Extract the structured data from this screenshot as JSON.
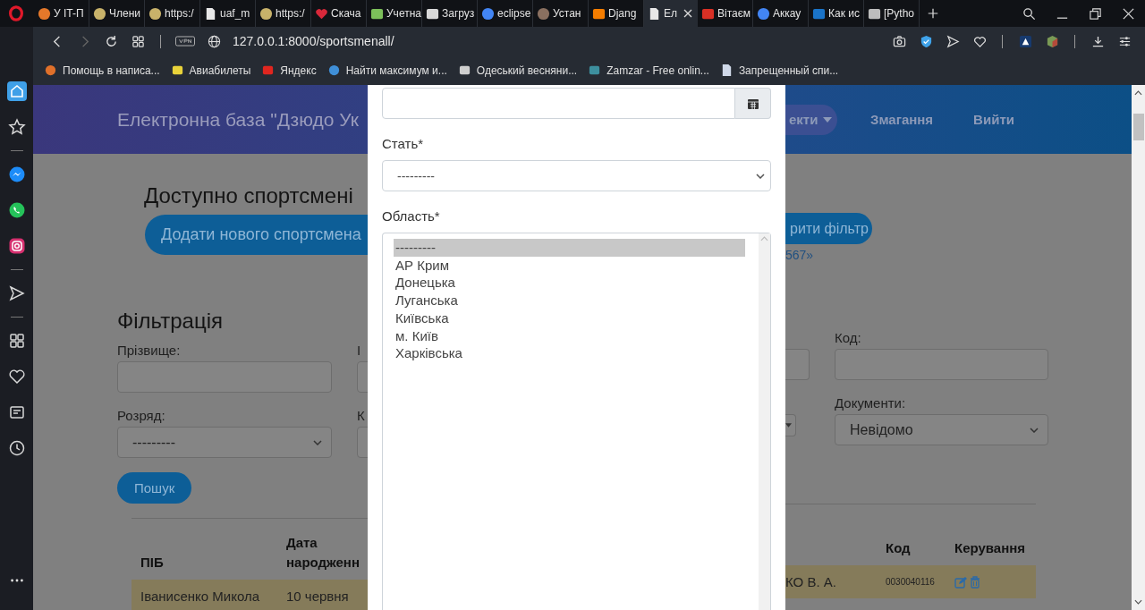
{
  "browser": {
    "tabs": [
      {
        "label": "У IT-П",
        "kind": "orange",
        "selected": false
      },
      {
        "label": "Члени",
        "kind": "globe",
        "selected": false
      },
      {
        "label": "https:/",
        "kind": "globe",
        "selected": false
      },
      {
        "label": "uaf_m",
        "kind": "page",
        "selected": false
      },
      {
        "label": "https:/",
        "kind": "globe",
        "selected": false
      },
      {
        "label": "Скача",
        "kind": "heart",
        "selected": false
      },
      {
        "label": "Учетна",
        "kind": "mail",
        "selected": false
      },
      {
        "label": "Загруз",
        "kind": "java",
        "selected": false
      },
      {
        "label": "eclipse",
        "kind": "google",
        "selected": false
      },
      {
        "label": "Устан",
        "kind": "round",
        "selected": false
      },
      {
        "label": "Djang",
        "kind": "blogger",
        "selected": false
      },
      {
        "label": "Ел",
        "kind": "page",
        "selected": true
      },
      {
        "label": "Вітаєм",
        "kind": "gmail",
        "selected": false
      },
      {
        "label": "Аккау",
        "kind": "google",
        "selected": false
      },
      {
        "label": "Как ис",
        "kind": "outlook",
        "selected": false
      },
      {
        "label": "[Pytho",
        "kind": "code",
        "selected": false
      }
    ],
    "address": "127.0.0.1:8000/sportsmenall/",
    "bookmarks": [
      {
        "label": "Помощь в написа...",
        "kind": "fox"
      },
      {
        "label": "Авиабилеты",
        "kind": "plane"
      },
      {
        "label": "Яндекс",
        "kind": "yandex"
      },
      {
        "label": "Найти максимум и...",
        "kind": "dots"
      },
      {
        "label": "Одеський весняни...",
        "kind": "bar"
      },
      {
        "label": "Zamzar - Free onlin...",
        "kind": "arrow"
      },
      {
        "label": "Запрещенный спи...",
        "kind": "doc"
      }
    ],
    "sidebar": {
      "groups": [
        {
          "items": [
            {
              "kind": "home",
              "selected": true
            },
            {
              "kind": "star",
              "selected": false
            }
          ]
        },
        {
          "items": [
            {
              "kind": "messenger",
              "selected": false
            },
            {
              "kind": "whatsapp",
              "selected": false
            },
            {
              "kind": "instagram",
              "selected": false
            }
          ]
        },
        {
          "items": [
            {
              "kind": "send",
              "selected": false
            }
          ]
        },
        {
          "items": [
            {
              "kind": "grid",
              "selected": false
            },
            {
              "kind": "heart",
              "selected": false
            },
            {
              "kind": "news",
              "selected": false
            },
            {
              "kind": "clock",
              "selected": false
            }
          ]
        }
      ]
    }
  },
  "page": {
    "header": {
      "title": "Електронна база \"Дзюдо Ук",
      "nav": [
        {
          "label": "екти",
          "kind": "dropdown"
        },
        {
          "label": "Змагання",
          "kind": "link"
        },
        {
          "label": "Вийти",
          "kind": "link"
        }
      ]
    },
    "heading": "Доступно спортсмені",
    "add_button": "Додати нового спортсмена",
    "filter_button": "рити фільтр",
    "link": "567»",
    "filter": {
      "title": "Фільтрація",
      "left": [
        {
          "label": "Прізвище:",
          "kind": "text"
        },
        {
          "label": "І",
          "kind": "text"
        },
        {
          "label": "Розряд:",
          "kind": "select",
          "value": "---------"
        },
        {
          "label": "К",
          "kind": "select"
        }
      ],
      "right": [
        {
          "kind": "text"
        },
        {
          "label": "Код:",
          "kind": "text"
        },
        {
          "kind": "select"
        },
        {
          "label": "Документи:",
          "kind": "select",
          "value": "Невідомо"
        }
      ],
      "search_button": "Пошук"
    },
    "table": {
      "columns": [
        "ПІБ",
        "Дата народженн",
        "Код",
        "Керування"
      ],
      "rows": [
        {
          "name": "Іванисенко Микола",
          "birth_date": "10 червня",
          "column_3": "КО В. А.",
          "code": "0030040116"
        }
      ]
    }
  },
  "modal": {
    "fields": [
      {
        "kind": "date"
      },
      {
        "kind": "select",
        "label": "Стать*",
        "value": "---------"
      },
      {
        "kind": "listbox",
        "label": "Область*",
        "options": [
          {
            "label": "---------",
            "selected": true
          },
          {
            "label": "АР Крим",
            "selected": false
          },
          {
            "label": "Донецька",
            "selected": false
          },
          {
            "label": "Луганська",
            "selected": false
          },
          {
            "label": "Київська",
            "selected": false
          },
          {
            "label": "м. Київ",
            "selected": false
          },
          {
            "label": "Харківська",
            "selected": false
          }
        ]
      }
    ]
  }
}
